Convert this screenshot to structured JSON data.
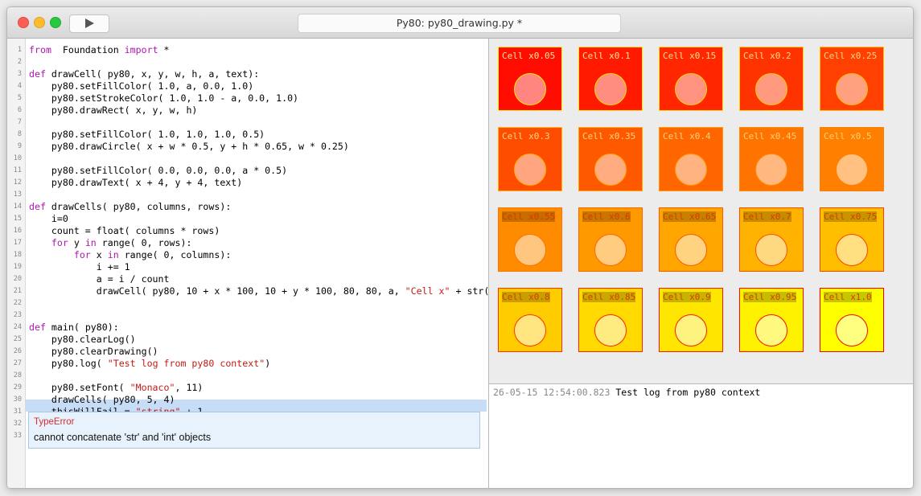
{
  "window": {
    "title": "Py80: py80_drawing.py *"
  },
  "toolbar": {
    "run_icon": "play-icon"
  },
  "editor": {
    "line_numbers": [
      "1",
      "2",
      "3",
      "4",
      "5",
      "6",
      "7",
      "8",
      "9",
      "10",
      "11",
      "12",
      "13",
      "14",
      "15",
      "16",
      "17",
      "18",
      "19",
      "20",
      "21",
      "22",
      "23",
      "24",
      "25",
      "26",
      "27",
      "28",
      "29",
      "30",
      "31",
      "32",
      "33"
    ],
    "lines": [
      [
        [
          "kw",
          "from"
        ],
        [
          "",
          "  Foundation "
        ],
        [
          "kw",
          "import"
        ],
        [
          "",
          " *"
        ]
      ],
      [],
      [
        [
          "kw",
          "def"
        ],
        [
          "",
          "",
          " drawCell( py80, x, y, w, h, a, text):"
        ]
      ],
      [
        [
          "",
          "    py80.setFillColor( 1.0, a, 0.0, 1.0)"
        ]
      ],
      [
        [
          "",
          "    py80.setStrokeColor( 1.0, 1.0 - a, 0.0, 1.0)"
        ]
      ],
      [
        [
          "",
          "    py80.drawRect( x, y, w, h)"
        ]
      ],
      [],
      [
        [
          "",
          "    py80.setFillColor( 1.0, 1.0, 1.0, 0.5)"
        ]
      ],
      [
        [
          "",
          "    py80.drawCircle( x + w * 0.5, y + h * 0.65, w * 0.25)"
        ]
      ],
      [],
      [
        [
          "",
          "    py80.setFillColor( 0.0, 0.0, 0.0, a * 0.5)"
        ]
      ],
      [
        [
          "",
          "    py80.drawText( x + 4, y + 4, text)"
        ]
      ],
      [],
      [
        [
          "kw",
          "def"
        ],
        [
          "",
          " drawCells( py80, columns, rows):"
        ]
      ],
      [
        [
          "",
          "    i=0"
        ]
      ],
      [
        [
          "",
          "    count = float( columns * rows)"
        ]
      ],
      [
        [
          "",
          "    "
        ],
        [
          "kw",
          "for"
        ],
        [
          "",
          " y "
        ],
        [
          "kw",
          "in"
        ],
        [
          "",
          " range( 0, rows):"
        ]
      ],
      [
        [
          "",
          "        "
        ],
        [
          "kw",
          "for"
        ],
        [
          "",
          " x "
        ],
        [
          "kw",
          "in"
        ],
        [
          "",
          " range( 0, columns):"
        ]
      ],
      [
        [
          "",
          "            i += 1"
        ]
      ],
      [
        [
          "",
          "            a = i / count"
        ]
      ],
      [
        [
          "",
          "            drawCell( py80, 10 + x * 100, 10 + y * 100, 80, 80, a, "
        ],
        [
          "str",
          "\"Cell x\""
        ],
        [
          "",
          " + str(a))"
        ]
      ],
      [],
      [],
      [
        [
          "kw",
          "def"
        ],
        [
          "",
          " main( py80):"
        ]
      ],
      [
        [
          "",
          "    py80.clearLog()"
        ]
      ],
      [
        [
          "",
          "    py80.clearDrawing()"
        ]
      ],
      [
        [
          "",
          "    py80.log( "
        ],
        [
          "str",
          "\"Test log from py80 context\""
        ],
        [
          "",
          ")"
        ]
      ],
      [],
      [
        [
          "",
          "    py80.setFont( "
        ],
        [
          "str",
          "\"Monaco\""
        ],
        [
          "",
          ", 11)"
        ]
      ],
      [
        [
          "",
          "    drawCells( py80, 5, 4)"
        ]
      ],
      [
        [
          "",
          "    thisWillFail = "
        ],
        [
          "str",
          "\"string\""
        ],
        [
          "",
          " + 1"
        ]
      ]
    ],
    "highlighted_line": 31
  },
  "error": {
    "type": "TypeError",
    "message": "cannot concatenate 'str' and 'int' objects"
  },
  "drawing": {
    "columns": 5,
    "rows": 4,
    "cells": [
      {
        "label": "Cell x0.05",
        "a": 0.05
      },
      {
        "label": "Cell x0.1",
        "a": 0.1
      },
      {
        "label": "Cell x0.15",
        "a": 0.15
      },
      {
        "label": "Cell x0.2",
        "a": 0.2
      },
      {
        "label": "Cell x0.25",
        "a": 0.25
      },
      {
        "label": "Cell x0.3",
        "a": 0.3
      },
      {
        "label": "Cell x0.35",
        "a": 0.35
      },
      {
        "label": "Cell x0.4",
        "a": 0.4
      },
      {
        "label": "Cell x0.45",
        "a": 0.45
      },
      {
        "label": "Cell x0.5",
        "a": 0.5
      },
      {
        "label": "Cell x0.55",
        "a": 0.55
      },
      {
        "label": "Cell x0.6",
        "a": 0.6
      },
      {
        "label": "Cell x0.65",
        "a": 0.65
      },
      {
        "label": "Cell x0.7",
        "a": 0.7
      },
      {
        "label": "Cell x0.75",
        "a": 0.75
      },
      {
        "label": "Cell x0.8",
        "a": 0.8
      },
      {
        "label": "Cell x0.85",
        "a": 0.85
      },
      {
        "label": "Cell x0.9",
        "a": 0.9
      },
      {
        "label": "Cell x0.95",
        "a": 0.95
      },
      {
        "label": "Cell x1.0",
        "a": 1.0
      }
    ]
  },
  "log": {
    "timestamp": "26-05-15 12:54:00.823",
    "message": "Test log from py80 context"
  }
}
